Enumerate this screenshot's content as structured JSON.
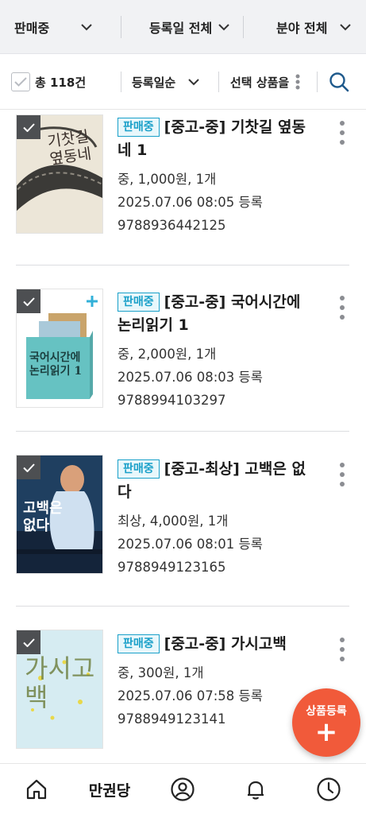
{
  "filters": {
    "status": "판매중",
    "date": "등록일 전체",
    "category": "분야 전체"
  },
  "toolbar": {
    "total": "총 118건",
    "sort": "등록일순",
    "selected_action": "선택 상품을"
  },
  "items": [
    {
      "status": "판매중",
      "title": "[중고-중] 기찻길 옆동네 1",
      "condition_price": "중, 1,000원, 1개",
      "registered": "2025.07.06 08:05 등록",
      "isbn": "9788936442125",
      "cover_text": "기찻길 옆동네"
    },
    {
      "status": "판매중",
      "title": "[중고-중] 국어시간에 논리읽기 1",
      "condition_price": "중, 2,000원, 1개",
      "registered": "2025.07.06 08:03 등록",
      "isbn": "9788994103297",
      "cover_text": "국어시간에 논리읽기 1"
    },
    {
      "status": "판매중",
      "title": "[중고-최상] 고백은 없다",
      "condition_price": "최상, 4,000원, 1개",
      "registered": "2025.07.06 08:01 등록",
      "isbn": "9788949123165",
      "cover_text": "고백은 없다"
    },
    {
      "status": "판매중",
      "title": "[중고-중] 가시고백",
      "condition_price": "중, 300원, 1개",
      "registered": "2025.07.06 07:58 등록",
      "isbn": "9788949123141",
      "cover_text": "가시고백"
    }
  ],
  "fab": {
    "label": "상품등록",
    "icon": "plus-icon"
  },
  "bottom_nav": {
    "brand": "만권당",
    "icons": [
      "home-icon",
      "profile-icon",
      "bell-icon",
      "clock-icon"
    ]
  },
  "colors": {
    "accent": "#1aa0c9",
    "fab": "#f15a3a",
    "search": "#1f5a8c"
  }
}
